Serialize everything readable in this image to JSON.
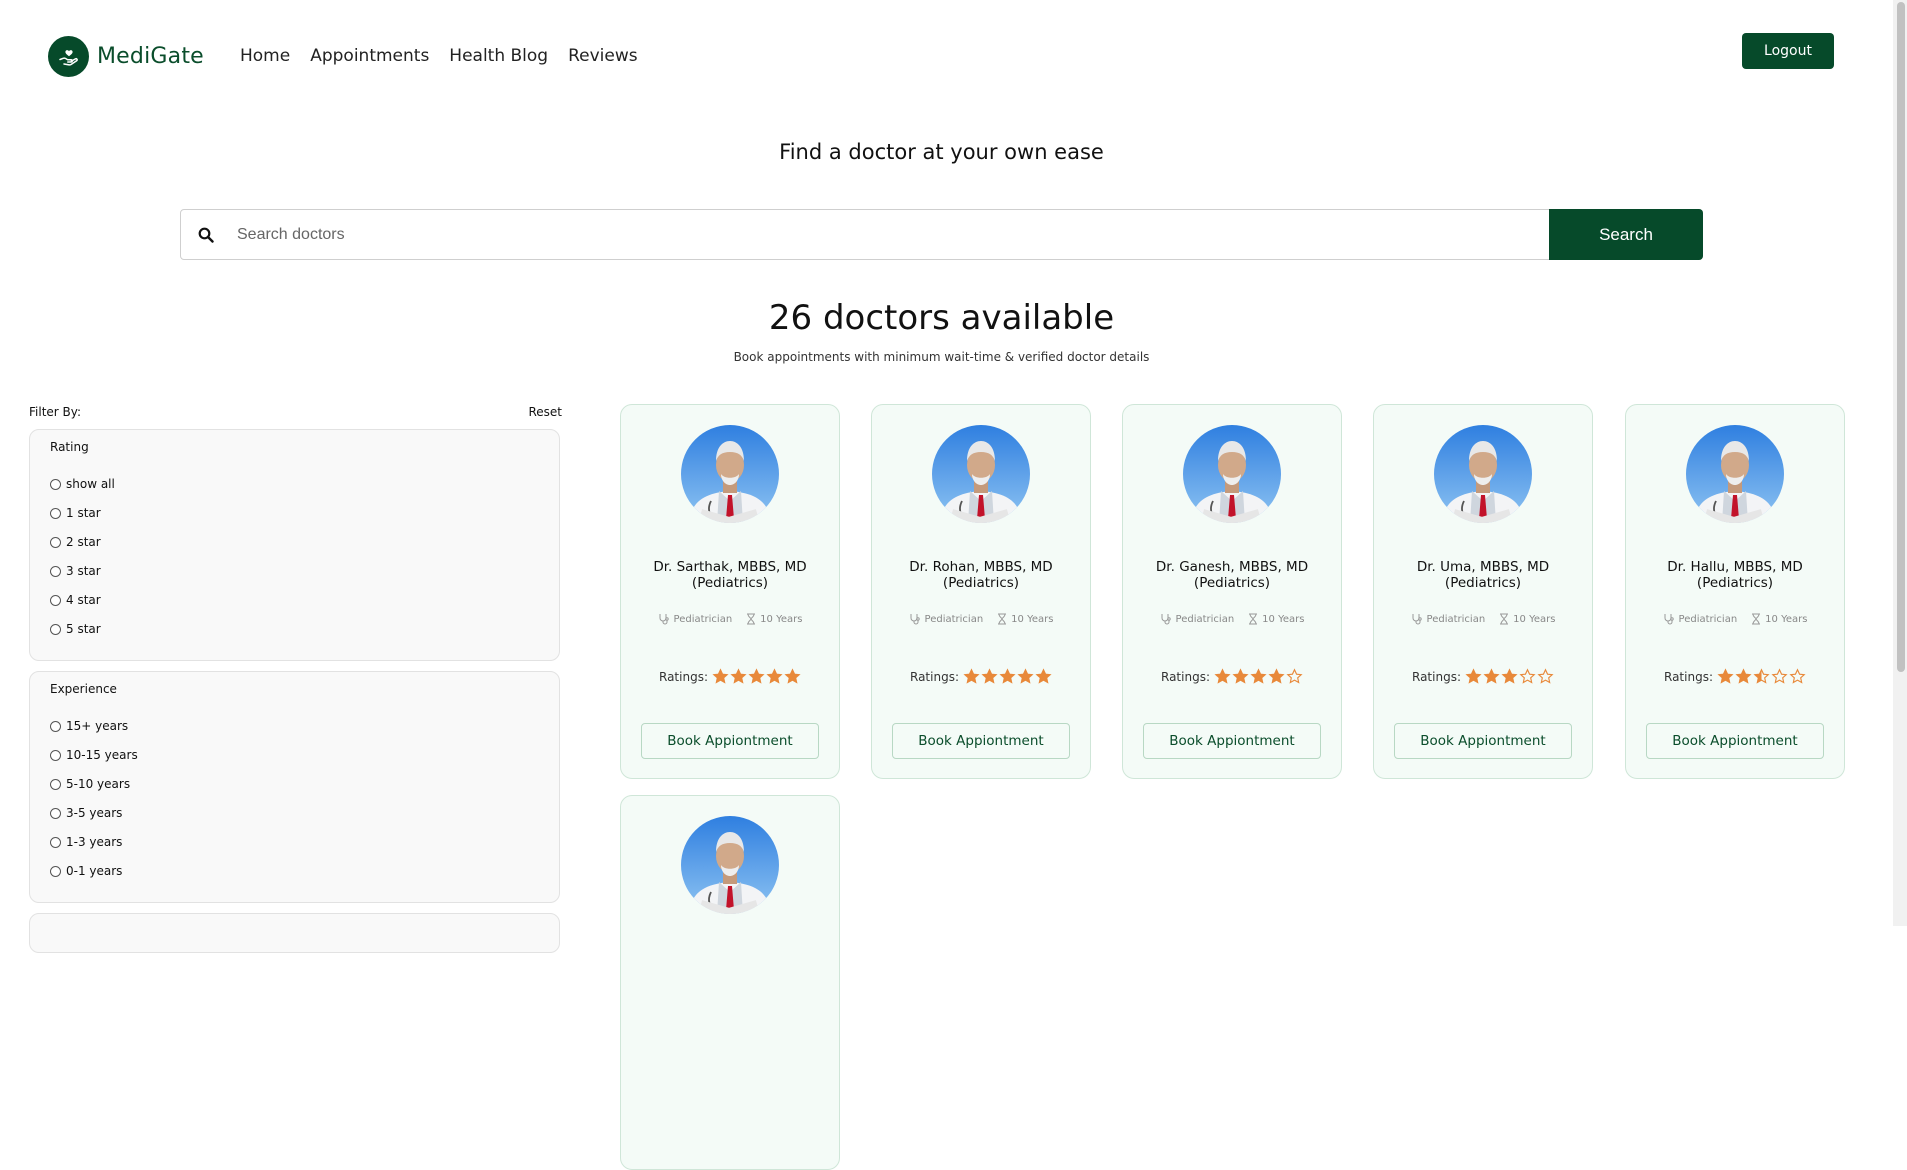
{
  "brand": {
    "name": "MediGate",
    "color": "#064a2a"
  },
  "nav": [
    {
      "label": "Home"
    },
    {
      "label": "Appointments"
    },
    {
      "label": "Health Blog"
    },
    {
      "label": "Reviews"
    }
  ],
  "header": {
    "logout_label": "Logout"
  },
  "hero": {
    "tagline": "Find a doctor at your own ease"
  },
  "search": {
    "placeholder": "Search doctors",
    "value": "",
    "button_label": "Search"
  },
  "results": {
    "count_text": "26 doctors available",
    "subtitle": "Book appointments with minimum wait-time & verified doctor details"
  },
  "filters": {
    "title": "Filter By:",
    "reset_label": "Reset",
    "groups": [
      {
        "title": "Rating",
        "options": [
          "show all",
          "1 star",
          "2 star",
          "3 star",
          "4 star",
          "5 star"
        ]
      },
      {
        "title": "Experience",
        "options": [
          "15+ years",
          "10-15 years",
          "5-10 years",
          "3-5 years",
          "1-3 years",
          "0-1 years"
        ]
      }
    ]
  },
  "doctors": [
    {
      "name_line1": "Dr. Sarthak, MBBS, MD",
      "name_line2": "(Pediatrics)",
      "specialty": "Pediatrician",
      "experience": "10 Years",
      "ratings_label": "Ratings:",
      "rating": 5,
      "book_label": "Book Appiontment"
    },
    {
      "name_line1": "Dr. Rohan, MBBS, MD",
      "name_line2": "(Pediatrics)",
      "specialty": "Pediatrician",
      "experience": "10 Years",
      "ratings_label": "Ratings:",
      "rating": 5,
      "book_label": "Book Appiontment"
    },
    {
      "name_line1": "Dr. Ganesh, MBBS, MD",
      "name_line2": "(Pediatrics)",
      "specialty": "Pediatrician",
      "experience": "10 Years",
      "ratings_label": "Ratings:",
      "rating": 4,
      "book_label": "Book Appiontment"
    },
    {
      "name_line1": "Dr. Uma, MBBS, MD",
      "name_line2": "(Pediatrics)",
      "specialty": "Pediatrician",
      "experience": "10 Years",
      "ratings_label": "Ratings:",
      "rating": 3,
      "book_label": "Book Appiontment"
    },
    {
      "name_line1": "Dr. Hallu, MBBS, MD",
      "name_line2": "(Pediatrics)",
      "specialty": "Pediatrician",
      "experience": "10 Years",
      "ratings_label": "Ratings:",
      "rating": 2.5,
      "book_label": "Book Appiontment"
    }
  ],
  "colors": {
    "accent": "#064a2a",
    "star": "#e8893a",
    "card_bg": "#f4fbf7"
  }
}
